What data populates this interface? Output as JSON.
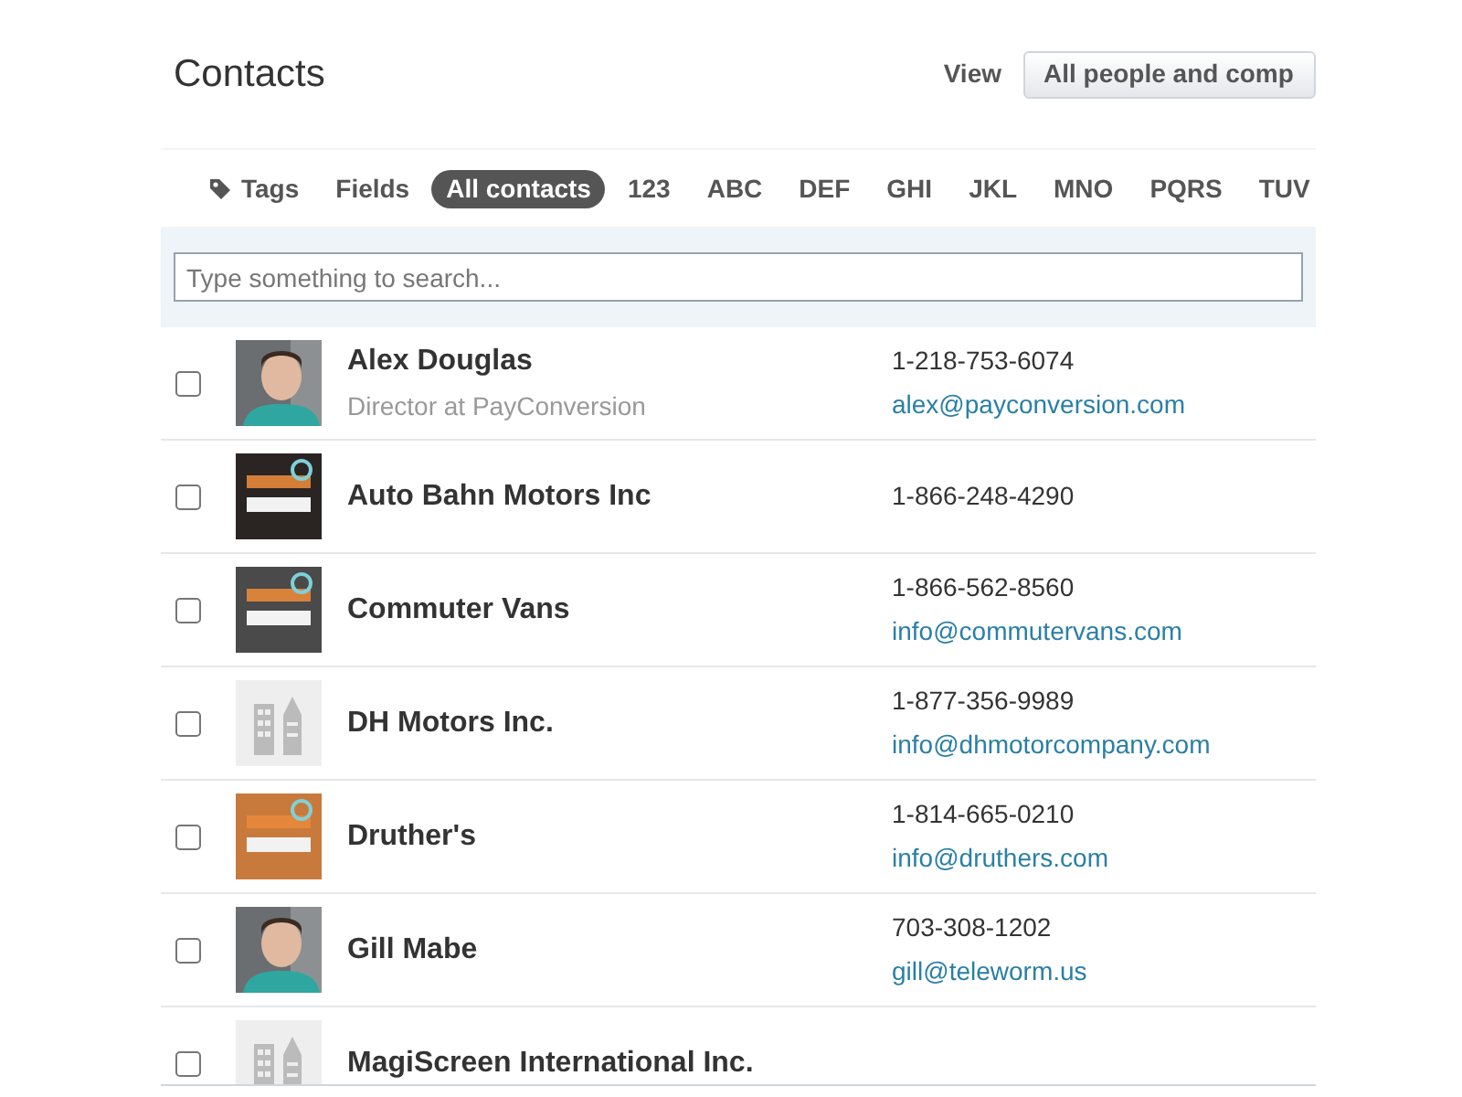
{
  "header": {
    "title": "Contacts",
    "view_label": "View",
    "view_value": "All people and comp"
  },
  "filters": [
    {
      "label": "Tags",
      "kind": "icon",
      "selected": false
    },
    {
      "label": "Fields",
      "kind": "text",
      "selected": false
    },
    {
      "label": "All contacts",
      "kind": "text",
      "selected": true
    },
    {
      "label": "123",
      "kind": "text",
      "selected": false
    },
    {
      "label": "ABC",
      "kind": "text",
      "selected": false
    },
    {
      "label": "DEF",
      "kind": "text",
      "selected": false
    },
    {
      "label": "GHI",
      "kind": "text",
      "selected": false
    },
    {
      "label": "JKL",
      "kind": "text",
      "selected": false
    },
    {
      "label": "MNO",
      "kind": "text",
      "selected": false
    },
    {
      "label": "PQRS",
      "kind": "text",
      "selected": false
    },
    {
      "label": "TUV",
      "kind": "text",
      "selected": false
    }
  ],
  "search": {
    "placeholder": "Type something to search..."
  },
  "contacts": [
    {
      "name": "Alex Douglas",
      "subtitle": "Director at PayConversion",
      "phone": "1-218-753-6074",
      "email": "alex@payconversion.com",
      "checked": false
    },
    {
      "name": "Auto Bahn Motors Inc",
      "phone": "1-866-248-4290",
      "checked": false,
      "avatar": {
        "kind": "logo"
      }
    },
    {
      "name": "Commuter Vans",
      "phone": "1-866-562-8560",
      "email": "info@commutervans.com",
      "checked": false,
      "avatar": {
        "kind": "logo"
      }
    },
    {
      "name": "DH Motors Inc.",
      "phone": "1-877-356-9989",
      "email": "info@dhmotorcompany.com",
      "checked": false,
      "avatar": {
        "kind": "default"
      }
    },
    {
      "name": "Druther's",
      "phone": "1-814-665-0210",
      "email": "info@druthers.com",
      "checked": false,
      "avatar": {
        "kind": "logo"
      }
    },
    {
      "name": "Gill Mabe",
      "phone": "703-308-1202",
      "email": "gill@teleworm.us",
      "checked": false
    },
    {
      "name": "MagiScreen International Inc.",
      "checked": false,
      "avatar": {
        "kind": "default"
      }
    }
  ]
}
